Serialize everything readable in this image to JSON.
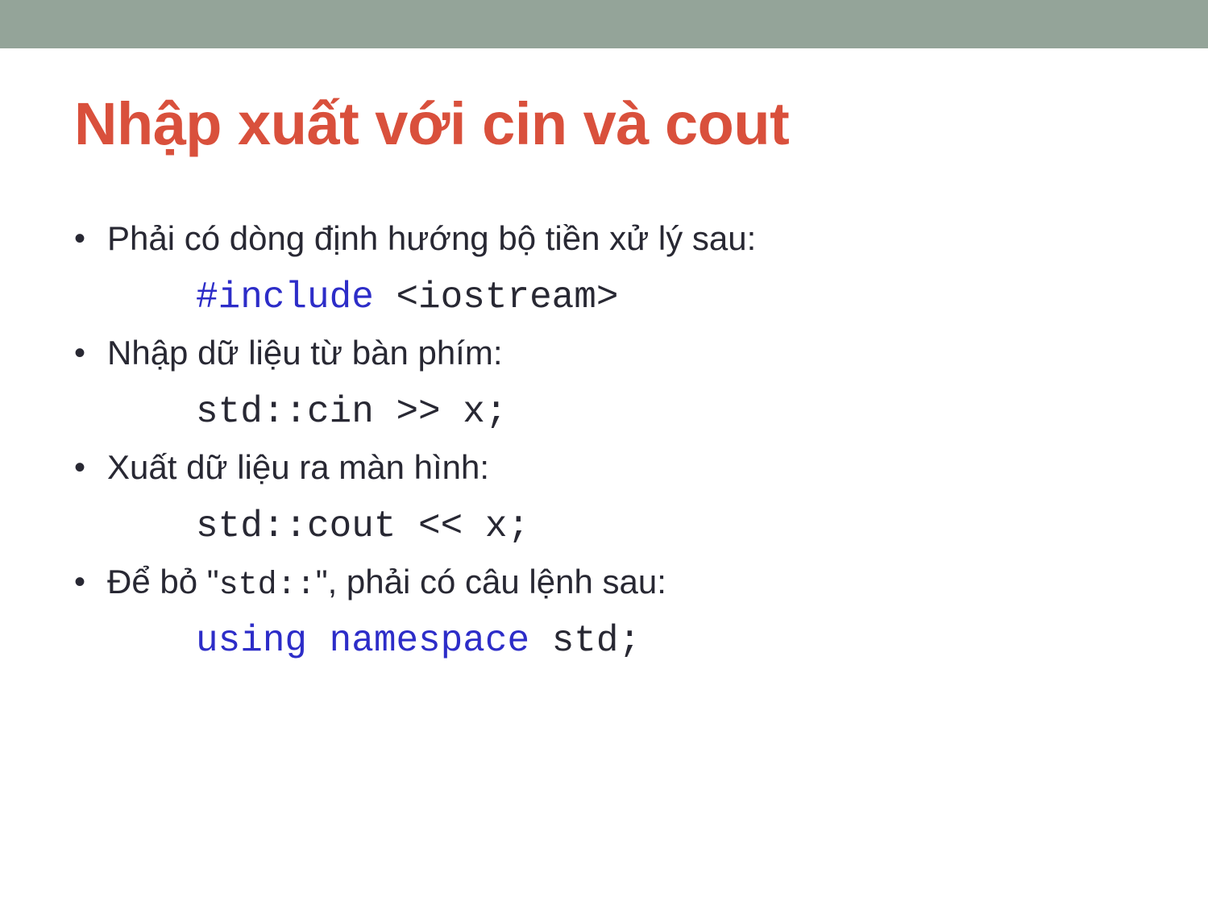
{
  "slide": {
    "title": "Nhập xuất với cin và cout",
    "colors": {
      "band": "#94a499",
      "title": "#d9503c",
      "body_text": "#282833",
      "code_keyword": "#2d2dc8",
      "background": "#ffffff"
    },
    "bullet_marker": "•",
    "blocks": [
      {
        "bullet": "Phải có dòng định hướng bộ tiền xử lý sau:",
        "code": {
          "keyword": "#include",
          "gap": " ",
          "plain": "<iostream>"
        }
      },
      {
        "bullet": "Nhập dữ liệu từ bàn phím:",
        "code": {
          "keyword": "",
          "gap": "",
          "plain": "std::cin >> x;"
        }
      },
      {
        "bullet": "Xuất dữ liệu ra màn hình:",
        "code": {
          "keyword": "",
          "gap": "",
          "plain": "std::cout << x;"
        }
      },
      {
        "bullet_prefix": "Để bỏ \"",
        "bullet_mono": "std::",
        "bullet_suffix": "\", phải có câu lệnh sau:",
        "code": {
          "keyword": "using namespace",
          "gap": " ",
          "plain": "std;"
        }
      }
    ]
  }
}
